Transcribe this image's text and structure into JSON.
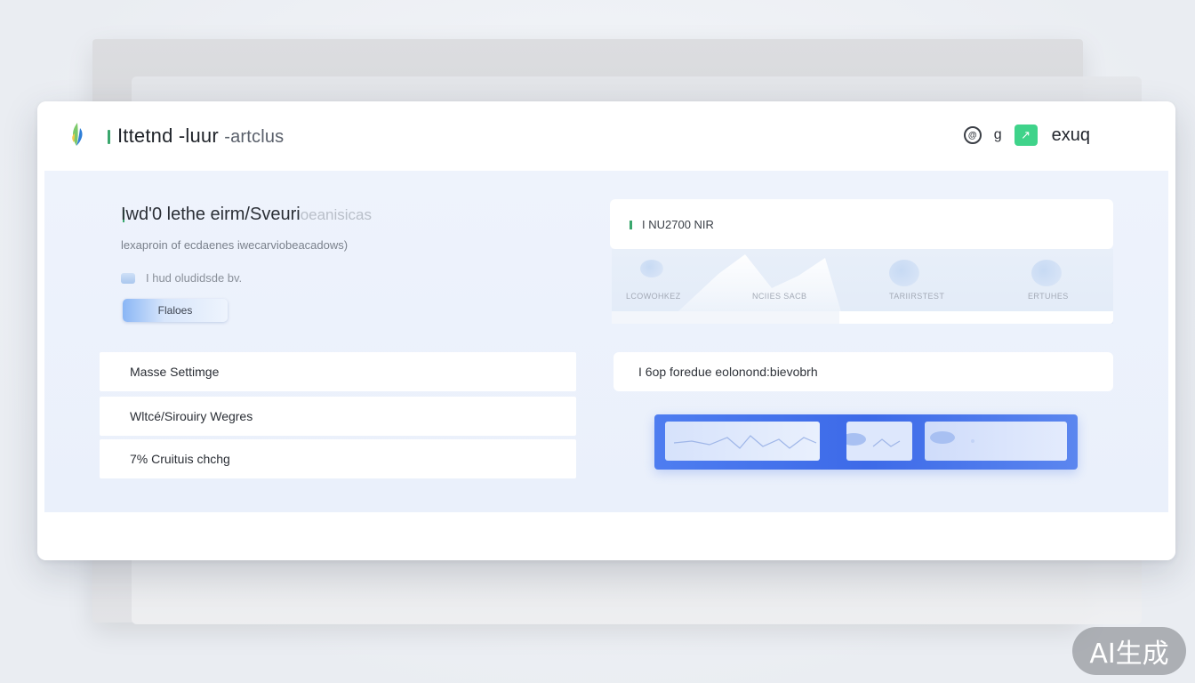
{
  "header": {
    "title_main": "Ittetnd -luur",
    "title_sub": "-artclus",
    "icon_circle_glyph": "@",
    "icon_mid_glyph": "ɡ",
    "icon_square_glyph": "↗",
    "user_label": "exuq"
  },
  "left": {
    "heading_main": "Iwd'0 lethe eirm/Sveuri",
    "heading_fade": "oeanisicas",
    "description": "lexaproin of ecdaenes iwecarviobeacadows)",
    "hint": "I hud oludidsde bv.",
    "pill_button": "Flaloes",
    "list": [
      {
        "label": "Masse Settimge"
      },
      {
        "label": "Wltcé/Sirouiry Wegres"
      },
      {
        "label": "7% Cruituis chchg"
      }
    ]
  },
  "right": {
    "top_card_title": "I NU2700 NIR",
    "stats": [
      {
        "label": "LCOWOHKEZ"
      },
      {
        "label": "NCIIES SACB"
      },
      {
        "label": "TARIIRSTEST"
      },
      {
        "label": "ERTUHES"
      }
    ],
    "bottom_card_title": "I 6op foredue eolonond:bievobrh"
  },
  "watermark": "AI生成",
  "colors": {
    "accent_green": "#3fd38a",
    "accent_blue": "#3d6ae8",
    "body_bg": "#eef3fc"
  }
}
